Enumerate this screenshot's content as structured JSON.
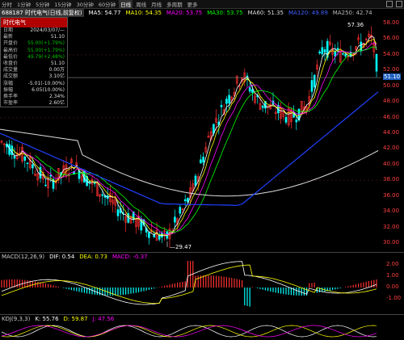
{
  "toolbar": {
    "periods": [
      "分时",
      "1分钟",
      "5分钟",
      "15分钟",
      "30分钟",
      "60分钟",
      "日线",
      "周线",
      "月线",
      "多周期",
      "更多"
    ],
    "active_index": 6
  },
  "header": {
    "stock_name": "688187 时代电气(日线,前复权)",
    "ma": [
      {
        "label": "MA5: 54.77",
        "color": "#ffffff"
      },
      {
        "label": "MA10: 54.35",
        "color": "#ffff00"
      },
      {
        "label": "MA20: 53.75",
        "color": "#ff00ff"
      },
      {
        "label": "MA30: 53.75",
        "color": "#00ff00"
      },
      {
        "label": "MA60: 51.35",
        "color": "#dddddd"
      },
      {
        "label": "MA120: 49.89",
        "color": "#4060ff"
      },
      {
        "label": "MA250: 42.74",
        "color": "#bbbbbb"
      }
    ]
  },
  "info_panel": {
    "title": "时代电气",
    "rows": [
      {
        "label": "日期",
        "value": "2024/03/07/—"
      },
      {
        "label": "最新",
        "value": "51.10"
      },
      {
        "label": "开盘价",
        "value": "55.00(+1.79%)"
      },
      {
        "label": "最高价",
        "value": "55.00(+1.79%)"
      },
      {
        "label": "最低价",
        "value": "49.79(+2.48%)"
      },
      {
        "label": "收盘价",
        "value": "51.10"
      },
      {
        "label": "成交量",
        "value": "0.00万"
      },
      {
        "label": "成交额",
        "value": "3.10亿"
      },
      {
        "label": "涨幅",
        "value": "-5.01(-10.00%)"
      },
      {
        "label": "振幅",
        "value": "6.05(10.00%)"
      },
      {
        "label": "换手率",
        "value": "2.34%"
      },
      {
        "label": "市盈率",
        "value": "2.60亿"
      }
    ]
  },
  "price_axis": {
    "ticks": [
      "58.00",
      "56.00",
      "54.00",
      "52.00",
      "50.00",
      "48.00",
      "46.00",
      "44.00",
      "42.00",
      "40.00",
      "38.00",
      "36.00",
      "34.00",
      "32.00",
      "30.00"
    ],
    "current": "51.10",
    "high_label": "57.36",
    "low_label": "29.47"
  },
  "macd": {
    "title": "MACD(12,26,9)",
    "dif": "DIF: 0.54",
    "dea": "DEA: 0.73",
    "macd": "MACD: -0.37",
    "ticks": [
      "2.00",
      "1.00",
      "0.00",
      "-1.00"
    ]
  },
  "kdj": {
    "title": "KDJ(9,3,3)",
    "k": "K: 55.76",
    "d": "D: 59.87",
    "j": "J: 47.56"
  },
  "colors": {
    "up": "#ff3030",
    "down": "#00ffff",
    "bg": "#000000"
  }
}
